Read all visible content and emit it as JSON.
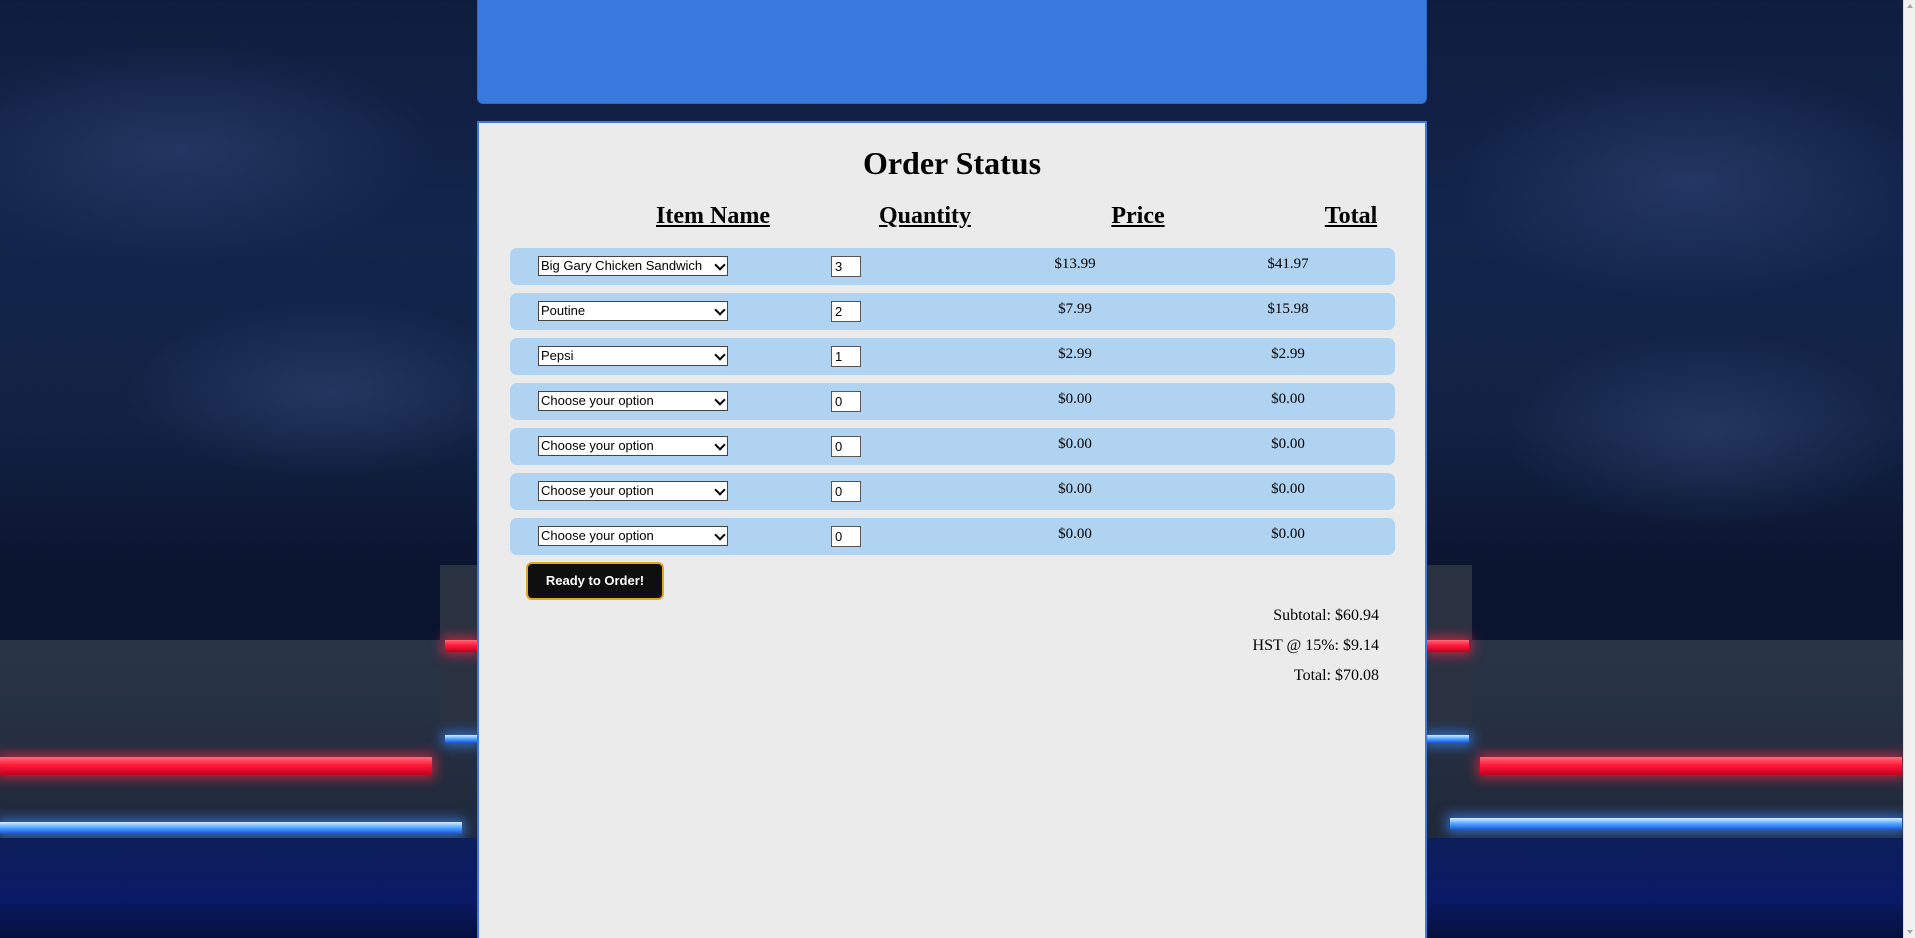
{
  "order": {
    "title": "Order Status",
    "columns": [
      "Item Name",
      "Quantity",
      "Price",
      "Total"
    ],
    "rows": [
      {
        "item": "Big Gary Chicken Sandwich",
        "quantity": "3",
        "price": "$13.99",
        "total": "$41.97"
      },
      {
        "item": "Poutine",
        "quantity": "2",
        "price": "$7.99",
        "total": "$15.98"
      },
      {
        "item": "Pepsi",
        "quantity": "1",
        "price": "$2.99",
        "total": "$2.99"
      },
      {
        "item": "Choose your option",
        "quantity": "0",
        "price": "$0.00",
        "total": "$0.00"
      },
      {
        "item": "Choose your option",
        "quantity": "0",
        "price": "$0.00",
        "total": "$0.00"
      },
      {
        "item": "Choose your option",
        "quantity": "0",
        "price": "$0.00",
        "total": "$0.00"
      },
      {
        "item": "Choose your option",
        "quantity": "0",
        "price": "$0.00",
        "total": "$0.00"
      }
    ],
    "order_button": "Ready to Order!",
    "subtotal": "Subtotal: $60.94",
    "tax": "HST @ 15%: $9.14",
    "total": "Total: $70.08"
  },
  "theme": {
    "header_color": "#3a7ade",
    "row_color": "#b0d3f2",
    "panel_color": "#ebebeb",
    "button_color": "#0f0f0f",
    "button_border": "#e3a81a"
  },
  "icons": {
    "select_arrow": "chevron-down-icon"
  }
}
